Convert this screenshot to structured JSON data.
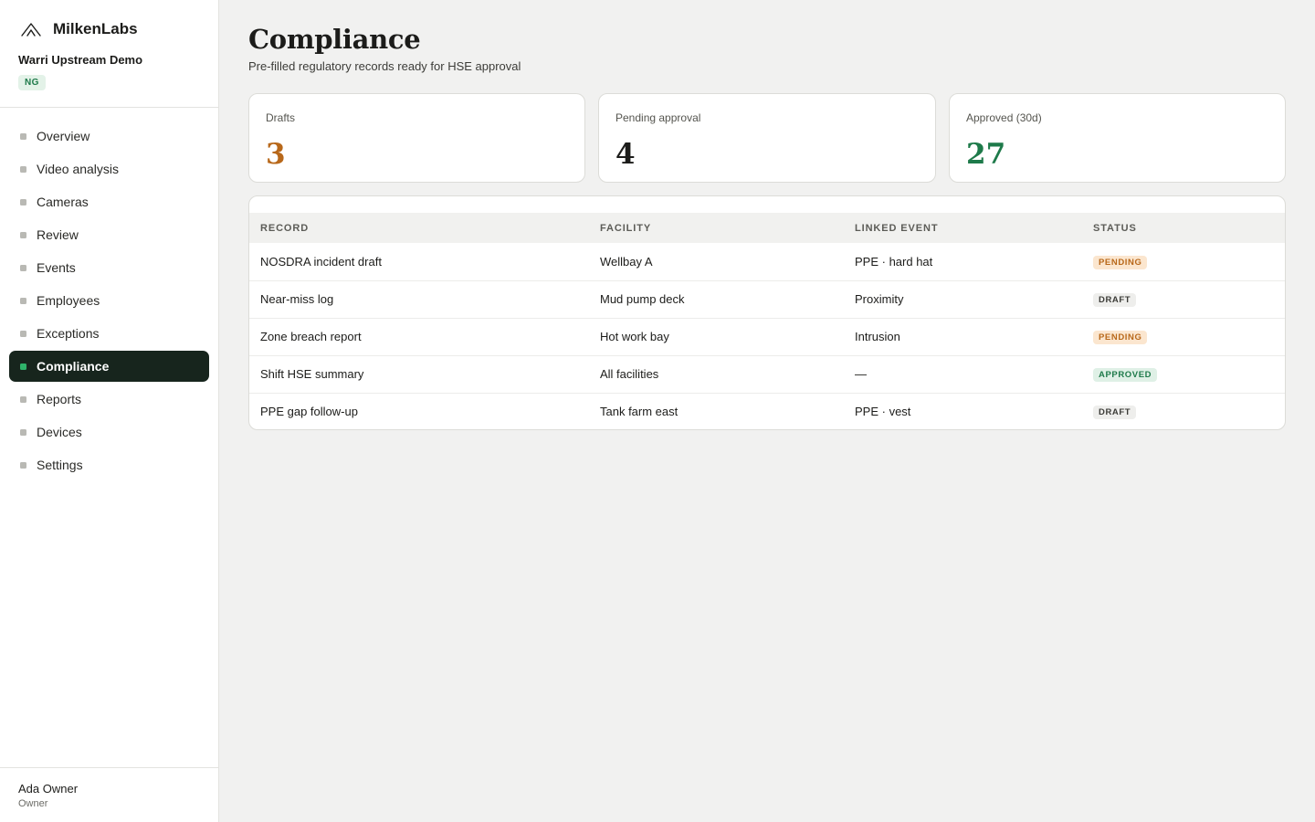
{
  "sidebar": {
    "brand": "MilkenLabs",
    "org_name": "Warri Upstream Demo",
    "region": "NG",
    "nav": [
      {
        "label": "Overview",
        "active": false
      },
      {
        "label": "Video analysis",
        "active": false
      },
      {
        "label": "Cameras",
        "active": false
      },
      {
        "label": "Review",
        "active": false
      },
      {
        "label": "Events",
        "active": false
      },
      {
        "label": "Employees",
        "active": false
      },
      {
        "label": "Exceptions",
        "active": false
      },
      {
        "label": "Compliance",
        "active": true
      },
      {
        "label": "Reports",
        "active": false
      },
      {
        "label": "Devices",
        "active": false
      },
      {
        "label": "Settings",
        "active": false
      }
    ],
    "user": {
      "name": "Ada Owner",
      "role": "Owner"
    }
  },
  "page": {
    "title": "Compliance",
    "subtitle": "Pre-filled regulatory records ready for HSE approval"
  },
  "stats": [
    {
      "label": "Drafts",
      "value": "3",
      "color": "#b8681a"
    },
    {
      "label": "Pending approval",
      "value": "4",
      "color": "#1c1c1a"
    },
    {
      "label": "Approved (30d)",
      "value": "27",
      "color": "#1e7a4a"
    }
  ],
  "table": {
    "columns": [
      "RECORD",
      "FACILITY",
      "LINKED EVENT",
      "STATUS"
    ],
    "rows": [
      {
        "record": "NOSDRA incident draft",
        "facility": "Wellbay A",
        "linked_event": "PPE · hard hat",
        "status": "PENDING"
      },
      {
        "record": "Near-miss log",
        "facility": "Mud pump deck",
        "linked_event": "Proximity",
        "status": "DRAFT"
      },
      {
        "record": "Zone breach report",
        "facility": "Hot work bay",
        "linked_event": "Intrusion",
        "status": "PENDING"
      },
      {
        "record": "Shift HSE summary",
        "facility": "All facilities",
        "linked_event": "—",
        "status": "APPROVED"
      },
      {
        "record": "PPE gap follow-up",
        "facility": "Tank farm east",
        "linked_event": "PPE · vest",
        "status": "DRAFT"
      }
    ]
  },
  "status_colors": {
    "PENDING": {
      "bg": "#fbe6cf",
      "fg": "#b8681a"
    },
    "DRAFT": {
      "bg": "#eeeeec",
      "fg": "#3c3c38"
    },
    "APPROVED": {
      "bg": "#dff0e6",
      "fg": "#1e7a4a"
    }
  },
  "accent": "#2fb36a",
  "active_nav_bg": "#17251d"
}
